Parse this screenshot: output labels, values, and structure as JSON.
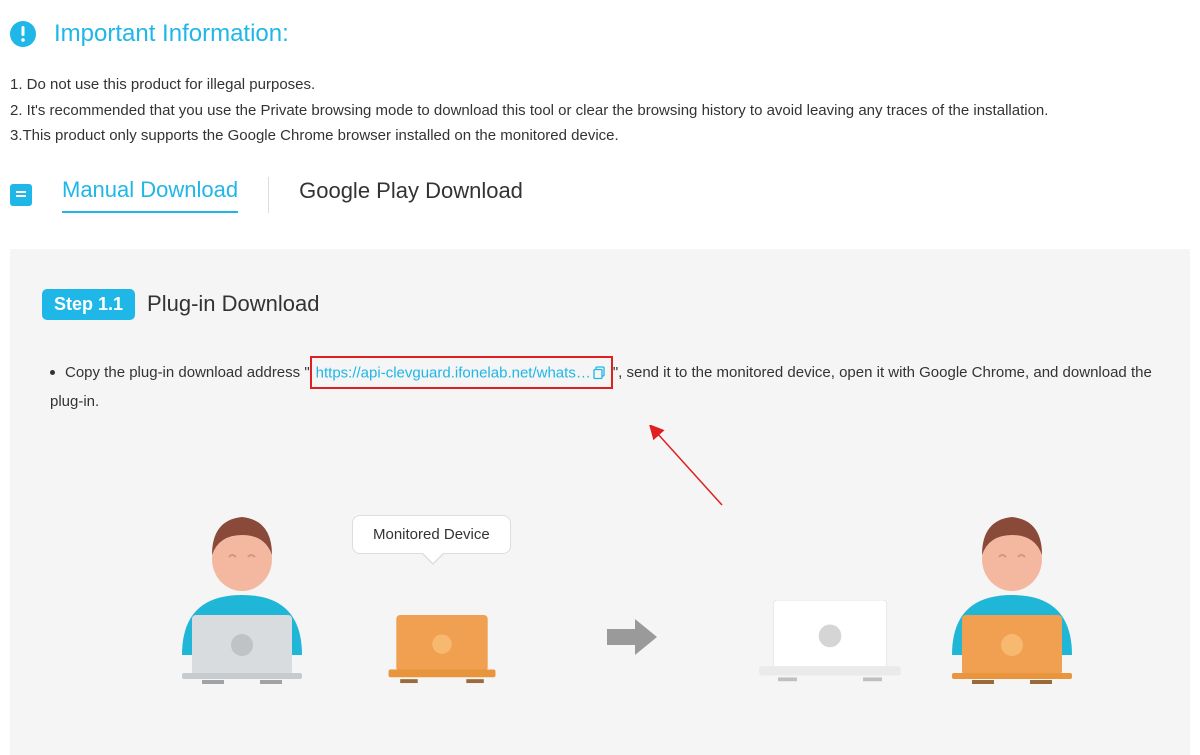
{
  "info": {
    "title": "Important Information:",
    "items": [
      "1. Do not use this product for illegal purposes.",
      "2. It's recommended that you use the Private browsing mode to download this tool or clear the browsing history to avoid leaving any traces of the installation.",
      "3.This product only supports the Google Chrome browser installed on the monitored device."
    ]
  },
  "tabs": {
    "manual": "Manual Download",
    "play": "Google Play Download"
  },
  "step": {
    "badge": "Step 1.1",
    "title": "Plug-in Download",
    "text_before": "Copy the plug-in download address \"",
    "url": "https://api-clevguard.ifonelab.net/whats…",
    "text_after": "\", send it to the monitored device, open it with Google Chrome, and download the plug-in."
  },
  "illustration": {
    "bubble": "Monitored Device"
  }
}
